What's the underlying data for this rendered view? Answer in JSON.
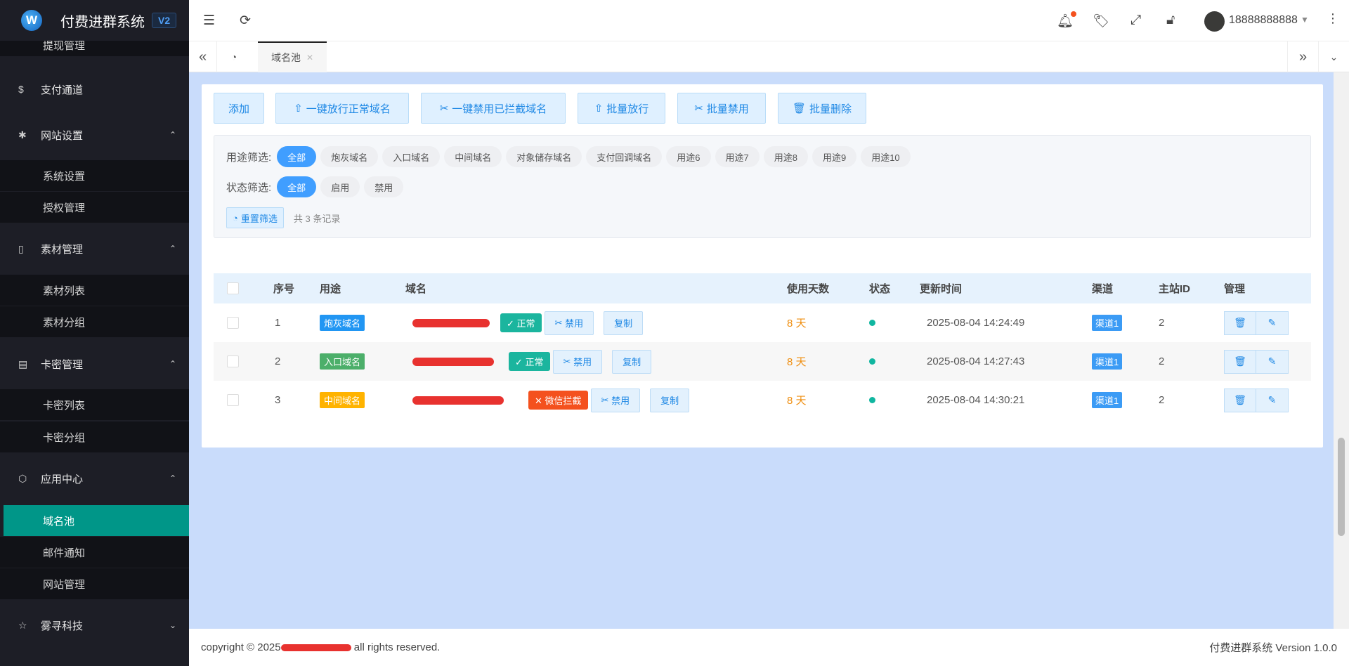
{
  "app": {
    "title": "付费进群系统",
    "version": "V2"
  },
  "sidebar": {
    "items": [
      {
        "label": "提现管理",
        "type": "sub"
      },
      {
        "label": "支付通道",
        "type": "group",
        "icon": "dollar-icon"
      },
      {
        "label": "网站设置",
        "type": "group",
        "icon": "gear-icon"
      },
      {
        "label": "系统设置",
        "type": "sub"
      },
      {
        "label": "授权管理",
        "type": "sub"
      },
      {
        "label": "素材管理",
        "type": "group",
        "icon": "file-icon"
      },
      {
        "label": "素材列表",
        "type": "sub"
      },
      {
        "label": "素材分组",
        "type": "sub"
      },
      {
        "label": "卡密管理",
        "type": "group",
        "icon": "document-icon"
      },
      {
        "label": "卡密列表",
        "type": "sub"
      },
      {
        "label": "卡密分组",
        "type": "sub"
      },
      {
        "label": "应用中心",
        "type": "group",
        "icon": "cube-icon"
      },
      {
        "label": "域名池",
        "type": "sub",
        "active": true
      },
      {
        "label": "邮件通知",
        "type": "sub"
      },
      {
        "label": "网站管理",
        "type": "sub"
      },
      {
        "label": "雾寻科技",
        "type": "group",
        "icon": "star-icon"
      }
    ]
  },
  "header": {
    "username": "18888888888"
  },
  "tabs": {
    "active": "域名池"
  },
  "toolbar": {
    "add": "添加",
    "release_normal": "一键放行正常域名",
    "ban_blocked": "一键禁用已拦截域名",
    "batch_release": "批量放行",
    "batch_ban": "批量禁用",
    "batch_delete": "批量删除"
  },
  "filters": {
    "purpose_label": "用途筛选:",
    "purpose_options": [
      "全部",
      "炮灰域名",
      "入口域名",
      "中间域名",
      "对象储存域名",
      "支付回调域名",
      "用途6",
      "用途7",
      "用途8",
      "用途9",
      "用途10"
    ],
    "status_label": "状态筛选:",
    "status_options": [
      "全部",
      "启用",
      "禁用"
    ],
    "reset": "重置筛选",
    "count": "共 3 条记录"
  },
  "table": {
    "headers": [
      "序号",
      "用途",
      "域名",
      "使用天数",
      "状态",
      "更新时间",
      "渠道",
      "主站ID",
      "管理"
    ],
    "rows": [
      {
        "no": "1",
        "purpose": "炮灰域名",
        "purpose_color": "#2196f3",
        "status": "正常",
        "status_color": "#1bb59e",
        "status_icon": "✓",
        "ban": "禁用",
        "copy": "复制",
        "days": "8 天",
        "updated": "2025-08-04 14:24:49",
        "channel": "渠道1",
        "site_id": "2"
      },
      {
        "no": "2",
        "purpose": "入口域名",
        "purpose_color": "#4caf6a",
        "status": "正常",
        "status_color": "#1bb59e",
        "status_icon": "✓",
        "ban": "禁用",
        "copy": "复制",
        "days": "8 天",
        "updated": "2025-08-04 14:27:43",
        "channel": "渠道1",
        "site_id": "2"
      },
      {
        "no": "3",
        "purpose": "中间域名",
        "purpose_color": "#ffb300",
        "status": "微信拦截",
        "status_color": "#f4511e",
        "status_icon": "✕",
        "ban": "禁用",
        "copy": "复制",
        "days": "8 天",
        "updated": "2025-08-04 14:30:21",
        "channel": "渠道1",
        "site_id": "2"
      }
    ]
  },
  "footer": {
    "copyright_prefix": "copyright © 2025",
    "copyright_suffix": "all rights reserved.",
    "version": "付费进群系统 Version 1.0.0"
  }
}
